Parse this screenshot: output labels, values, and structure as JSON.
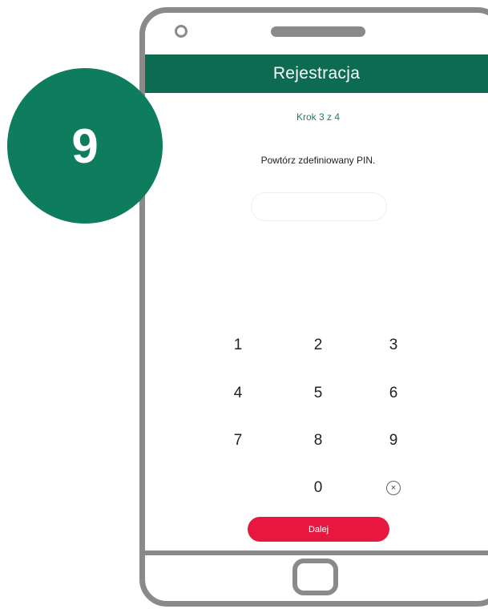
{
  "badge": {
    "number": "9"
  },
  "screen": {
    "title": "Rejestracja",
    "step": "Krok 3 z 4",
    "instruction": "Powtórz zdefiniowany PIN.",
    "pin_value": "",
    "keypad": [
      "1",
      "2",
      "3",
      "4",
      "5",
      "6",
      "7",
      "8",
      "9",
      "0"
    ],
    "delete_symbol": "×",
    "next_label": "Dalej"
  },
  "colors": {
    "header": "#0d6b51",
    "badge": "#0d7d5d",
    "step_text": "#1c7f5e",
    "button": "#e8173f",
    "frame": "#8a8a8a"
  },
  "icons": [
    "camera-icon",
    "speaker-icon",
    "delete-icon",
    "home-button-icon"
  ]
}
